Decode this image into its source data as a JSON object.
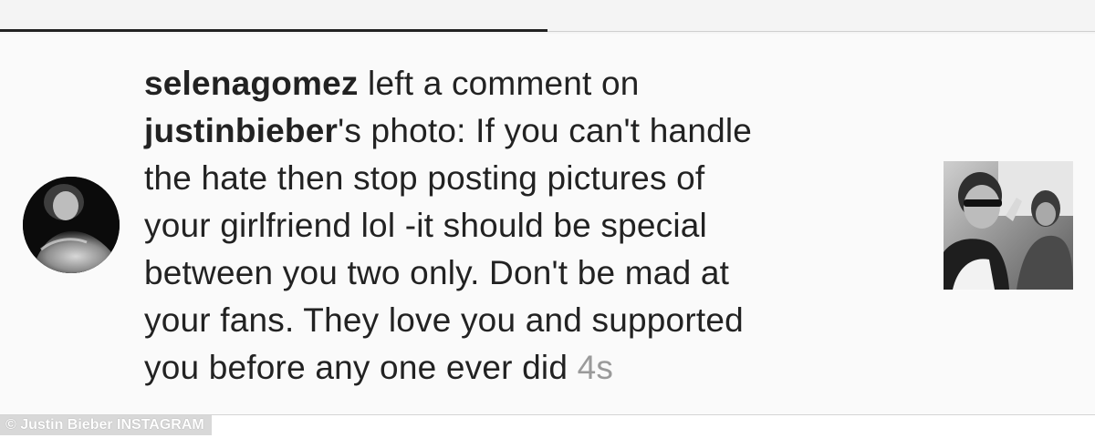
{
  "notification": {
    "username": "selenagomez",
    "action_text": " left a comment on ",
    "target_username": "justinbieber",
    "comment_prefix": "'s photo: ",
    "comment_lines": [
      "If you can't handle",
      "the hate then stop posting pictures of",
      "your girlfriend lol -it should be special",
      "between you two only. Don't be mad at",
      "your fans. They love you and supported",
      "you before any one ever did"
    ],
    "timestamp": "4s"
  },
  "credit": {
    "text": "© Justin Bieber INSTAGRAM"
  },
  "colors": {
    "text": "#222222",
    "timestamp": "#9a9a9a",
    "background": "#fafafa",
    "tab_indicator": "#222222"
  },
  "icons": {
    "avatar": "profile-photo",
    "thumbnail": "post-photo"
  }
}
